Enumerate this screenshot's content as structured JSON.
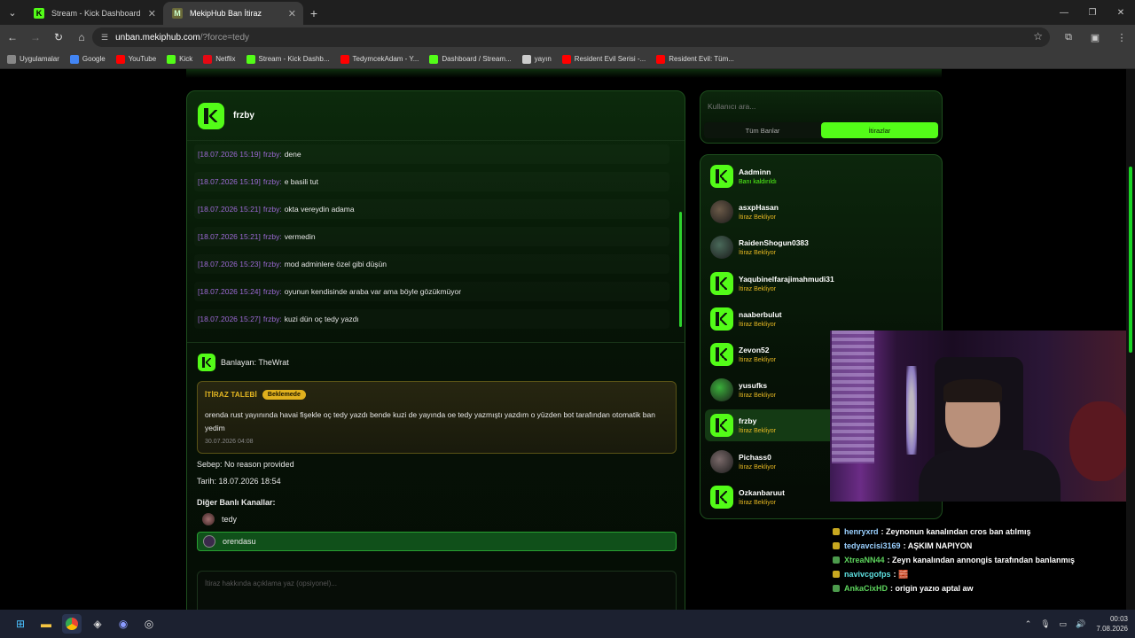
{
  "browser": {
    "tabs": [
      {
        "title": "Stream - Kick Dashboard",
        "active": false
      },
      {
        "title": "MekipHub Ban İtiraz",
        "active": true
      }
    ],
    "url_host": "unban.mekiphub.com",
    "url_path": "/?force=tedy",
    "bookmarks": [
      {
        "label": "Uygulamalar",
        "color": "#888888"
      },
      {
        "label": "Google",
        "color": "#4285f4"
      },
      {
        "label": "YouTube",
        "color": "#ff0000"
      },
      {
        "label": "Kick",
        "color": "#53fc18"
      },
      {
        "label": "Netflix",
        "color": "#e50914"
      },
      {
        "label": "Stream - Kick Dashb...",
        "color": "#53fc18"
      },
      {
        "label": "TedymcekAdam - Y...",
        "color": "#ff0000"
      },
      {
        "label": "Dashboard / Stream...",
        "color": "#53fc18"
      },
      {
        "label": "yayın",
        "color": "#cccccc"
      },
      {
        "label": "Resident Evil Serisi -...",
        "color": "#ff0000"
      },
      {
        "label": "Resident Evil: Tüm...",
        "color": "#ff0000"
      }
    ]
  },
  "main": {
    "user": "frzby",
    "messages": [
      {
        "ts": "[18.07.2026 15:19]",
        "user": "frzby:",
        "text": "dene"
      },
      {
        "ts": "[18.07.2026 15:19]",
        "user": "frzby:",
        "text": "e basili tut"
      },
      {
        "ts": "[18.07.2026 15:21]",
        "user": "frzby:",
        "text": "okta vereydin adama"
      },
      {
        "ts": "[18.07.2026 15:21]",
        "user": "frzby:",
        "text": "vermedin"
      },
      {
        "ts": "[18.07.2026 15:23]",
        "user": "frzby:",
        "text": "mod adminlere özel gibi düşün"
      },
      {
        "ts": "[18.07.2026 15:24]",
        "user": "frzby:",
        "text": "oyunun kendisinde araba var ama böyle gözükmüyor"
      },
      {
        "ts": "[18.07.2026 15:27]",
        "user": "frzby:",
        "text": "kuzi dün oç tedy yazdı"
      }
    ],
    "banned_by": "Banlayan: TheWrat",
    "appeal": {
      "label": "İTİRAZ TALEBİ",
      "badge": "Beklemede",
      "text": "orenda rust yayınında havai fişekle oç tedy yazdı bende kuzi de yayında oe tedy yazmıştı yazdım o yüzden bot tarafından otomatik ban yedim",
      "date": "30.07.2026 04:08"
    },
    "reason": "Sebep: No reason provided",
    "date": "Tarih: 18.07.2026 18:54",
    "other_title": "Diğer Banlı Kanallar:",
    "other_channels": [
      {
        "name": "tedy",
        "selected": false
      },
      {
        "name": "orendasu",
        "selected": true
      }
    ],
    "comment_placeholder": "İtiraz hakkında açıklama yaz (opsiyonel)..."
  },
  "sidebar": {
    "search_placeholder": "Kullanıcı ara...",
    "tabs": [
      "Tüm Banlar",
      "İtirazlar"
    ],
    "active_tab": "İtirazlar",
    "users": [
      {
        "name": "Aadminn",
        "status": "Banı kaldırıldı",
        "avatar": "kick"
      },
      {
        "name": "asxpHasan",
        "status": "İtiraz Bekliyor",
        "avatar": "photo"
      },
      {
        "name": "RaidenShogun0383",
        "status": "İtiraz Bekliyor",
        "avatar": "photo"
      },
      {
        "name": "Yaqubinelfarajimahmudi31",
        "status": "İtiraz Bekliyor",
        "avatar": "kick"
      },
      {
        "name": "naaberbulut",
        "status": "İtiraz Bekliyor",
        "avatar": "kick"
      },
      {
        "name": "Zevon52",
        "status": "İtiraz Bekliyor",
        "avatar": "kick"
      },
      {
        "name": "yusufks",
        "status": "İtiraz Bekliyor",
        "avatar": "photo"
      },
      {
        "name": "frzby",
        "status": "İtiraz Bekliyor",
        "avatar": "kick",
        "selected": true
      },
      {
        "name": "Pichass0",
        "status": "İtiraz Bekliyor",
        "avatar": "photo"
      },
      {
        "name": "Ozkanbaruut",
        "status": "İtiraz Bekliyor",
        "avatar": "kick"
      }
    ]
  },
  "stream_chat": [
    {
      "name": "henryxrd",
      "color": "#9ad0ff",
      "msg": ": Zeynonun kanalından cros ban atılmış"
    },
    {
      "name": "tedyavcisi3169",
      "color": "#9ad0ff",
      "msg": ": AŞKIM NAPIYON"
    },
    {
      "name": "XtreaNN44",
      "color": "#5dd45d",
      "msg": ": Zeyn kanalından annongis tarafından banlanmış"
    },
    {
      "name": "navivcgofps",
      "color": "#5ee0e0",
      "msg": ": 🧱"
    },
    {
      "name": "AnkaCixHD",
      "color": "#5dd45d",
      "msg": ": origin yazıo aptal aw"
    }
  ],
  "taskbar": {
    "time": "00:03",
    "date": "7.08.2026"
  }
}
